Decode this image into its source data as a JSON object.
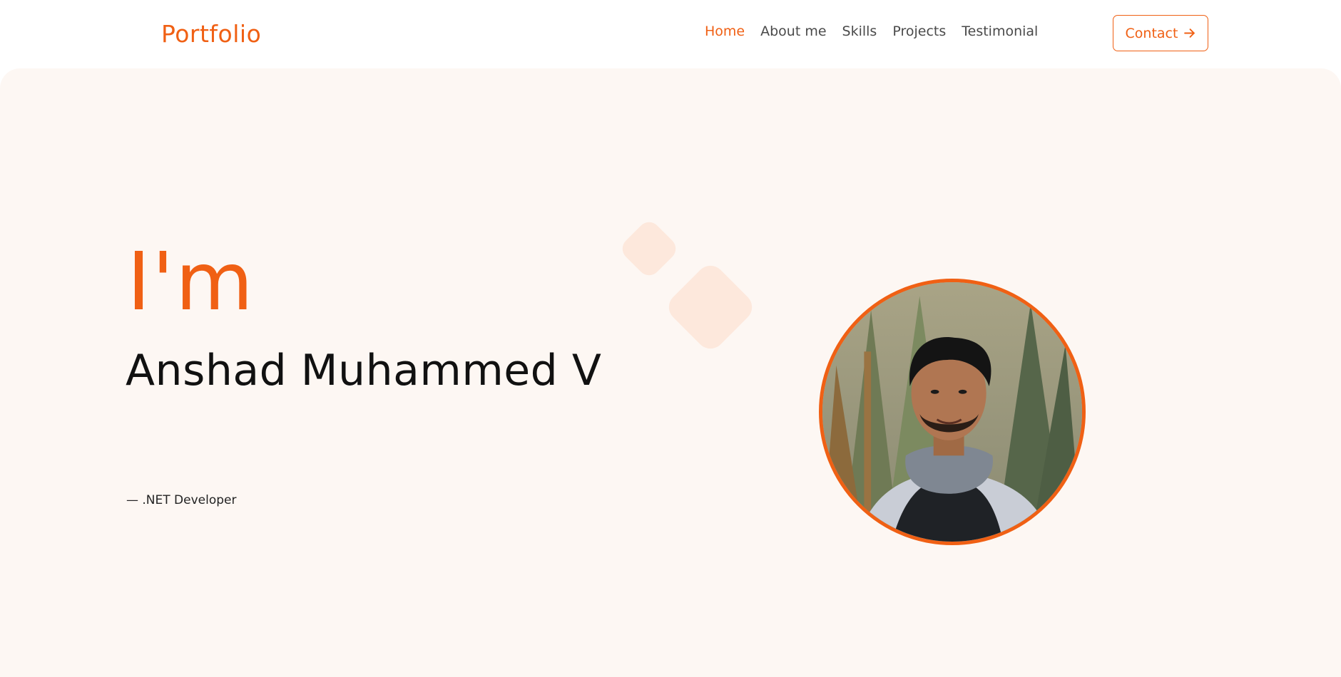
{
  "header": {
    "logo": "Portfolio",
    "nav": [
      {
        "label": "Home",
        "active": true
      },
      {
        "label": "About me",
        "active": false
      },
      {
        "label": "Skills",
        "active": false
      },
      {
        "label": "Projects",
        "active": false
      },
      {
        "label": "Testimonial",
        "active": false
      }
    ],
    "contact_label": "Contact",
    "contact_icon": "arrow-right-icon"
  },
  "hero": {
    "intro": "I'm",
    "name": "Anshad Muhammed V",
    "role": "— .NET Developer",
    "photo": "profile-photo"
  },
  "colors": {
    "accent": "#f06014",
    "hero_bg": "#fdf7f3",
    "diamond": "#fde8dc",
    "nav_text": "#4a4a4a"
  }
}
